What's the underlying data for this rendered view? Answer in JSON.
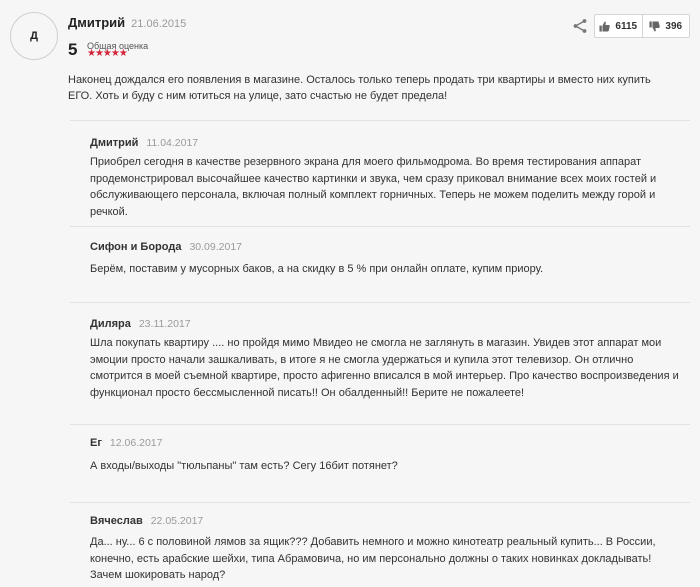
{
  "review": {
    "avatar_letter": "Д",
    "author": "Дмитрий",
    "date": "21.06.2015",
    "score": "5",
    "score_label": "Общая оценка",
    "stars": "★★★★★",
    "star_rating": 5,
    "likes": "6115",
    "dislikes": "396",
    "text": "Наконец дождался его появления в магазине. Осталось только теперь продать три квартиры и вместо них купить ЕГО. Хоть и буду с ним ютиться на улице, зато счастью не будет предела!"
  },
  "replies": [
    {
      "author": "Дмитрий",
      "date": "11.04.2017",
      "text": "Приобрел сегодня в качестве резервного экрана для моего фильмодрома. Во время тестирования аппарат продемонстрировал высочайшее качество картинки и звука, чем сразу приковал внимание всех моих гостей и обслуживающего персонала, включая полный комплект горничных. Теперь не можем поделить между горой и речкой."
    },
    {
      "author": "Сифон и Борода",
      "date": "30.09.2017",
      "text": "Берём, поставим у мусорных баков, а на скидку в 5 % при онлайн оплате, купим приору."
    },
    {
      "author": "Диляра",
      "date": "23.11.2017",
      "text": "Шла покупать квартиру .... но пройдя мимо Мвидео не смогла не заглянуть в магазин. Увидев этот аппарат мои эмоции просто начали зашкаливать, в итоге я не смогла удержаться и купила этот телевизор. Он отлично смотрится в моей съемной квартире, просто афигенно вписался в мой интерьер. Про качество воспроизведения и функционал просто бессмысленной писать!! Он обалденный!! Берите не пожалеете!"
    },
    {
      "author": "Ег",
      "date": "12.06.2017",
      "text": "А входы/выходы \"тюльпаны\" там есть? Сегу 16бит потянет?"
    },
    {
      "author": "Вячеслав",
      "date": "22.05.2017",
      "text": "Да... ну... 6 с половиной лямов за ящик??? Добавить немного и можно кинотеатр реальный купить... В России, конечно, есть арабские шейхи, типа Абрамовича, но им персонально должны о таких новинках докладывать! Зачем шокировать народ?"
    }
  ]
}
